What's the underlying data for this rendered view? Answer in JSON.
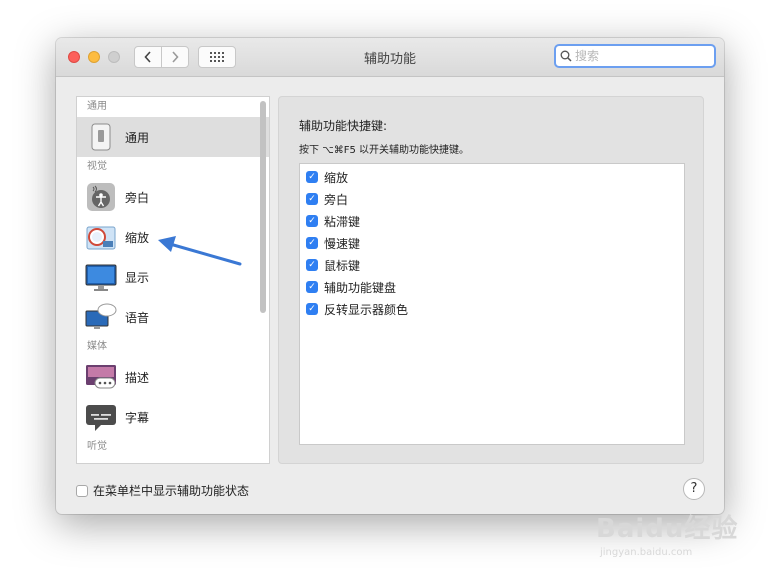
{
  "window": {
    "title": "辅助功能"
  },
  "search": {
    "placeholder": "搜索",
    "value": ""
  },
  "sidebar": {
    "sections": [
      {
        "header": "通用",
        "items": [
          {
            "label": "通用",
            "icon": "general-icon",
            "selected": true
          }
        ]
      },
      {
        "header": "视觉",
        "items": [
          {
            "label": "旁白",
            "icon": "voiceover-icon"
          },
          {
            "label": "缩放",
            "icon": "zoom-icon"
          },
          {
            "label": "显示",
            "icon": "display-icon"
          },
          {
            "label": "语音",
            "icon": "speech-icon"
          }
        ]
      },
      {
        "header": "媒体",
        "items": [
          {
            "label": "描述",
            "icon": "descriptions-icon"
          },
          {
            "label": "字幕",
            "icon": "captions-icon"
          }
        ]
      },
      {
        "header": "听觉",
        "items": []
      }
    ]
  },
  "panel": {
    "title": "辅助功能快捷键:",
    "hint": "按下 ⌥⌘F5 以开关辅助功能快捷键。",
    "options": [
      {
        "label": "缩放",
        "checked": true
      },
      {
        "label": "旁白",
        "checked": true
      },
      {
        "label": "粘滞键",
        "checked": true
      },
      {
        "label": "慢速键",
        "checked": true
      },
      {
        "label": "鼠标键",
        "checked": true
      },
      {
        "label": "辅助功能键盘",
        "checked": true
      },
      {
        "label": "反转显示器颜色",
        "checked": true
      }
    ]
  },
  "footer": {
    "menubar_checkbox_label": "在菜单栏中显示辅助功能状态",
    "menubar_checked": false,
    "help_label": "?"
  },
  "watermark": {
    "brand": "Baidu经验",
    "url": "jingyan.baidu.com"
  },
  "colors": {
    "accent": "#2f7ff2",
    "annotation_arrow": "#3a78d4",
    "selected_row": "#dedede"
  }
}
